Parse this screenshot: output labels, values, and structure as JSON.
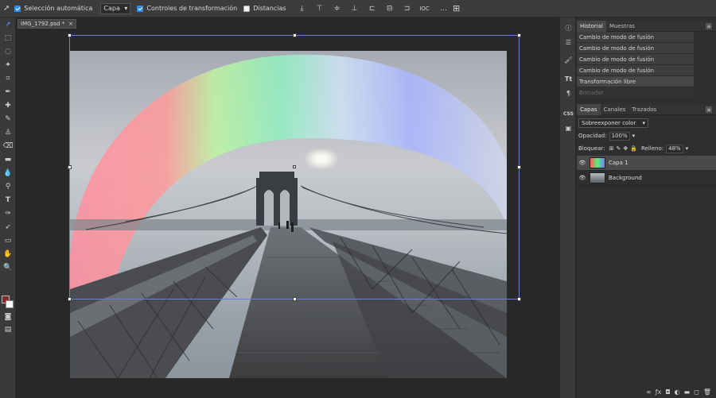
{
  "options_bar": {
    "auto_select_label": "Selección automática",
    "auto_select_target": "Capa",
    "transform_controls_label": "Controles de transformación",
    "distances_label": "Distancias",
    "align_icons": [
      "align-top-icon",
      "align-middle-icon",
      "align-bottom-icon",
      "align-left-icon",
      "align-center-icon",
      "align-right-icon",
      "distribute-icon",
      "more-icon",
      "grid-icon"
    ],
    "more_label": "...",
    "distribute_label": "IOC"
  },
  "document": {
    "tab_title": "IMG_1792.psd *",
    "close_glyph": "×"
  },
  "panels": {
    "history": {
      "tabs": [
        "Historial",
        "Muestras"
      ],
      "items": [
        {
          "label": "Cambio de modo de fusión",
          "state": "normal"
        },
        {
          "label": "Cambio de modo de fusión",
          "state": "normal"
        },
        {
          "label": "Cambio de modo de fusión",
          "state": "normal"
        },
        {
          "label": "Cambio de modo de fusión",
          "state": "normal"
        },
        {
          "label": "Transformación libre",
          "state": "active"
        },
        {
          "label": "Borrador",
          "state": "dim"
        }
      ]
    },
    "layers": {
      "tabs": [
        "Capas",
        "Canales",
        "Trazados"
      ],
      "blend_mode": "Sobreexponer color",
      "opacity_label": "Opacidad:",
      "opacity_value": "100%",
      "lock_label": "Bloquear:",
      "fill_label": "Relleno:",
      "fill_value": "48%",
      "items": [
        {
          "name": "Capa 1",
          "active": true
        },
        {
          "name": "Background",
          "active": false
        }
      ]
    }
  },
  "colors": {
    "foreground": "#8b2a2a",
    "background": "#ffffff",
    "accent": "#2f8fe8",
    "transform_box": "#6d7fc8"
  }
}
